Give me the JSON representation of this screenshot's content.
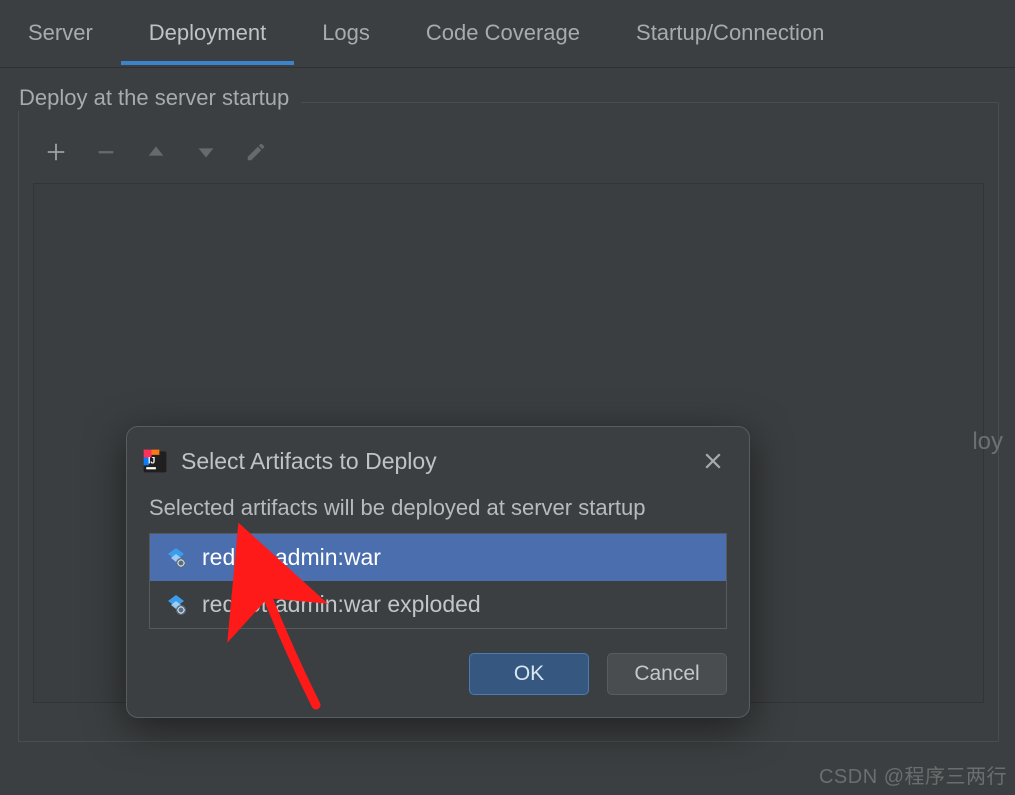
{
  "tabs": {
    "server": "Server",
    "deployment": "Deployment",
    "logs": "Logs",
    "code_coverage": "Code Coverage",
    "startup_connection": "Startup/Connection"
  },
  "section": {
    "legend": "Deploy at the server startup"
  },
  "ghost": "loy",
  "dialog": {
    "title": "Select Artifacts to Deploy",
    "desc": "Selected artifacts will be deployed at server startup",
    "items": [
      {
        "label": "redpot-admin:war",
        "selected": true
      },
      {
        "label": "redpot-admin:war exploded",
        "selected": false
      }
    ],
    "ok": "OK",
    "cancel": "Cancel"
  },
  "watermark": "CSDN @程序三两行"
}
